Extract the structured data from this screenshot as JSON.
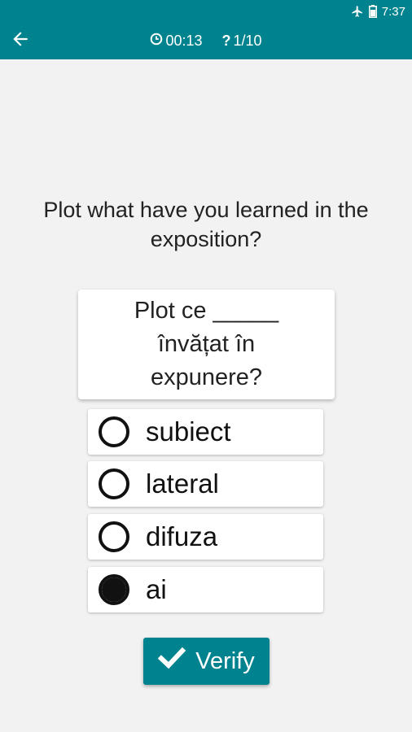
{
  "status_bar": {
    "time": "7:37"
  },
  "app_bar": {
    "timer": "00:13",
    "progress": "1/10",
    "progress_icon_glyph": "?"
  },
  "quiz": {
    "question": "Plot what have you learned in the exposition?",
    "sentence": "Plot ce _____ învățat în expunere?",
    "options": [
      {
        "label": "subiect",
        "selected": false
      },
      {
        "label": "lateral",
        "selected": false
      },
      {
        "label": "difuza",
        "selected": false
      },
      {
        "label": "ai",
        "selected": true
      }
    ],
    "verify_label": "Verify"
  },
  "colors": {
    "primary": "#00838f",
    "background": "#f2f2f2",
    "card": "#ffffff",
    "text": "#222222"
  }
}
